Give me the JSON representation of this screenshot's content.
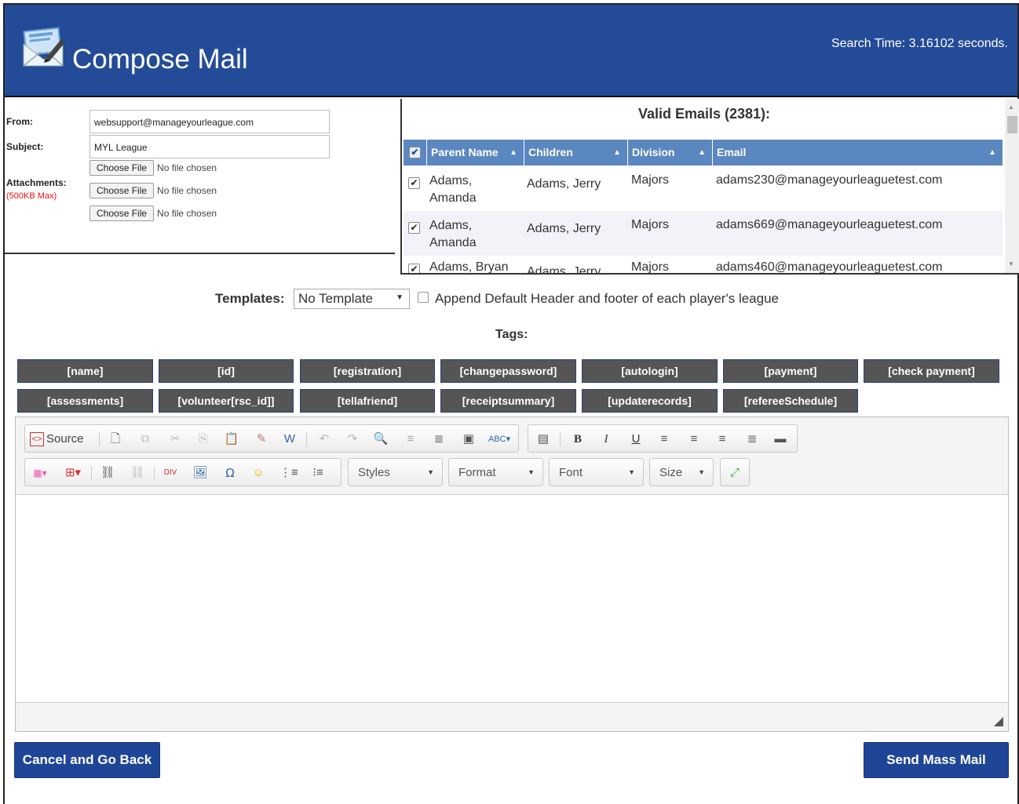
{
  "header": {
    "title": "Compose Mail",
    "search_time": "Search Time: 3.16102 seconds.",
    "icon": "mail-compose-icon"
  },
  "form": {
    "from_label": "From:",
    "from_value": "websupport@manageyourleague.com",
    "subject_label": "Subject:",
    "subject_value": "MYL League",
    "attachments_label": "Attachments:",
    "attachments_max": "(500KB Max)",
    "choose_file_label": "Choose File",
    "no_file_text": "No file chosen"
  },
  "emails": {
    "title": "Valid Emails (2381):",
    "columns": [
      "Parent Name",
      "Children",
      "Division",
      "Email"
    ],
    "rows": [
      {
        "parent": "Adams, Amanda",
        "child": "Adams, Jerry",
        "division": "Majors",
        "email": "adams230@manageyourleaguetest.com"
      },
      {
        "parent": "Adams, Amanda",
        "child": "Adams, Jerry",
        "division": "Majors",
        "email": "adams669@manageyourleaguetest.com"
      },
      {
        "parent": "Adams, Bryan",
        "child": "Adams, Jerry",
        "division": "Majors",
        "email": "adams460@manageyourleaguetest.com"
      }
    ]
  },
  "templates": {
    "label": "Templates:",
    "selected": "No Template",
    "append_label": "Append Default Header and footer of each player's league"
  },
  "tags": {
    "label": "Tags:",
    "items": [
      "[name]",
      "[id]",
      "[registration]",
      "[changepassword]",
      "[autologin]",
      "[payment]",
      "[check payment]",
      "[assessments]",
      "[volunteer[rsc_id]]",
      "[tellafriend]",
      "[receiptsummary]",
      "[updaterecords]",
      "[refereeSchedule]"
    ]
  },
  "editor": {
    "source_label": "Source",
    "styles_label": "Styles",
    "format_label": "Format",
    "font_label": "Font",
    "size_label": "Size",
    "bold_glyph": "B",
    "italic_glyph": "I",
    "underline_glyph": "U"
  },
  "actions": {
    "cancel_label": "Cancel and Go Back",
    "send_label": "Send Mass Mail"
  },
  "colors": {
    "header_bg": "#244b98",
    "grid_header_bg": "#5b87c0",
    "tag_bg": "#555555",
    "button_bg": "#1f4597"
  }
}
